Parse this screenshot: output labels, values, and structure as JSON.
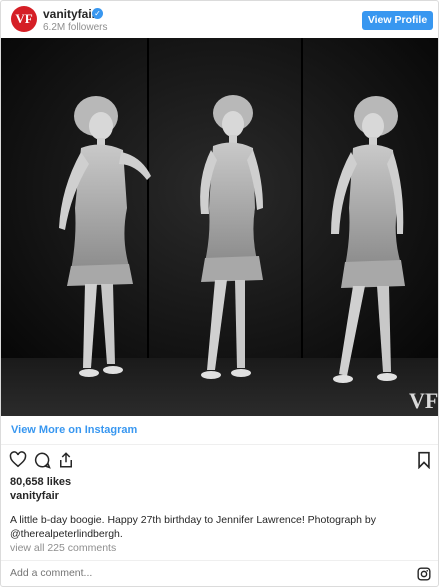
{
  "post": {
    "username": "vanityfair",
    "avatar_text": "VF",
    "followers": "6.2M followers",
    "view_profile_label": "View Profile",
    "photo_watermark": "VF",
    "view_more_label": "View More on Instagram",
    "likes": "80,658 likes",
    "caption_username": "vanityfair",
    "caption_text": "A little b-day boogie. Happy 27th birthday to Jennifer Lawrence! Photograph by @therealpeterlindbergh.",
    "view_all_comments": "view all 225 comments",
    "comment_placeholder": "Add a comment..."
  },
  "icons": {
    "verified": "verified-badge-icon",
    "like": "heart-icon",
    "comment": "comment-icon",
    "share": "share-icon",
    "save": "bookmark-icon",
    "instagram": "instagram-icon"
  },
  "colors": {
    "accent": "#3897f0",
    "brand": "#d51f26",
    "muted_text": "#8e8e8e",
    "border": "#dbdbdb"
  }
}
